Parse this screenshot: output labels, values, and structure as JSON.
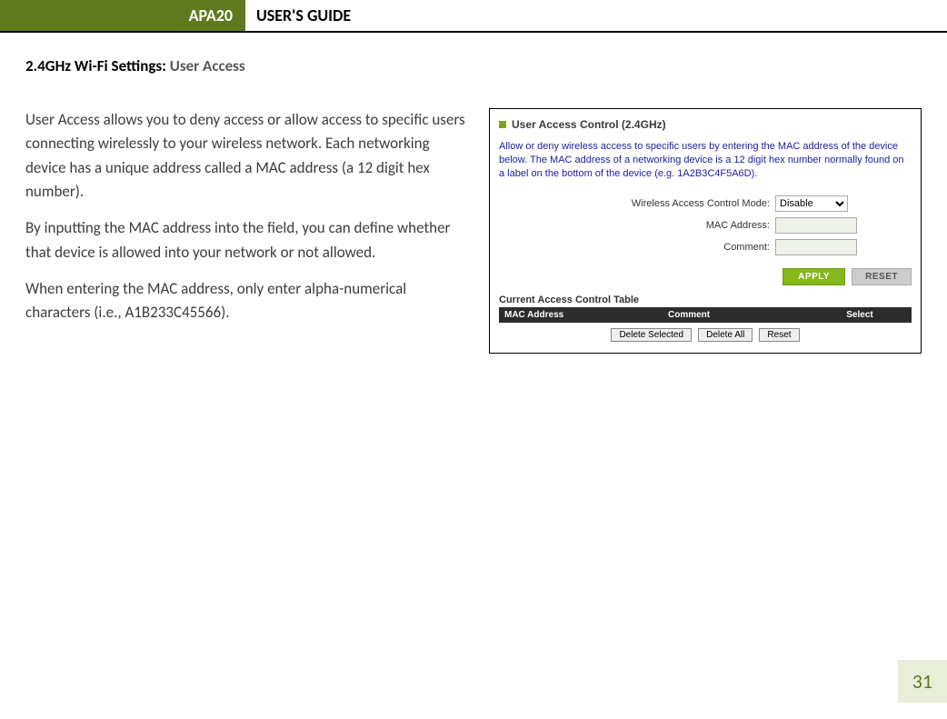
{
  "header": {
    "product": "APA20",
    "title": "USER'S GUIDE"
  },
  "section": {
    "heading_bold": "2.4GHz Wi-Fi Settings: ",
    "heading_gray": "User Access"
  },
  "body": {
    "p1": "User Access allows you to deny access or allow access to specific users connecting wirelessly to your wireless network. Each networking device has a unique address called a MAC address (a 12 digit hex number).",
    "p2": "By inputting the MAC address into the field, you can define whether that device is allowed into your network or not allowed.",
    "p3": "When entering the MAC address, only enter alpha-numerical characters (i.e., A1B233C45566)."
  },
  "panel": {
    "title": "User Access Control (2.4GHz)",
    "desc": "Allow or deny wireless access to specific users by entering the MAC address of the device below. The MAC address of a networking device is a 12 digit hex number normally found on a label on the bottom of the device (e.g. 1A2B3C4F5A6D).",
    "labels": {
      "mode": "Wireless Access Control Mode:",
      "mac": "MAC Address:",
      "comment": "Comment:"
    },
    "mode_value": "Disable",
    "buttons": {
      "apply": "APPLY",
      "reset": "RESET"
    },
    "table": {
      "caption": "Current Access Control Table",
      "cols": {
        "c1": "MAC Address",
        "c2": "Comment",
        "c3": "Select"
      },
      "btns": {
        "delete_selected": "Delete Selected",
        "delete_all": "Delete All",
        "reset": "Reset"
      }
    }
  },
  "page_number": "31"
}
